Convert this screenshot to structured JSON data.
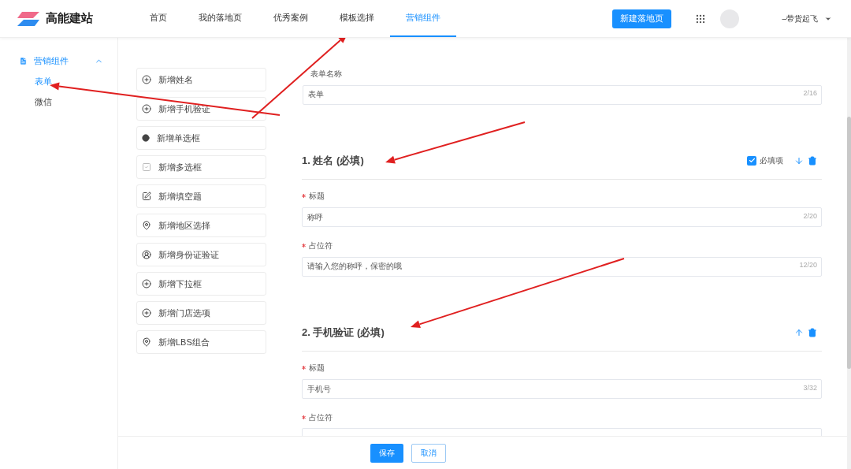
{
  "brand": {
    "name": "高能建站"
  },
  "nav": [
    {
      "label": "首页",
      "selected": false
    },
    {
      "label": "我的落地页",
      "selected": false
    },
    {
      "label": "优秀案例",
      "selected": false
    },
    {
      "label": "模板选择",
      "selected": false
    },
    {
      "label": "营销组件",
      "selected": true
    }
  ],
  "new_button": "新建落地页",
  "user": {
    "name": "–带货起飞"
  },
  "sidebar": {
    "group": {
      "label": "营销组件",
      "expanded": true,
      "children": [
        {
          "label": "表单",
          "selected": true
        },
        {
          "label": "微信",
          "selected": false
        }
      ]
    }
  },
  "components": [
    {
      "label": "新增姓名",
      "kind": "plus"
    },
    {
      "label": "新增手机验证",
      "kind": "plus"
    },
    {
      "label": "新增单选框",
      "kind": "radio"
    },
    {
      "label": "新增多选框",
      "kind": "checkbox"
    },
    {
      "label": "新增填空题",
      "kind": "edit"
    },
    {
      "label": "新增地区选择",
      "kind": "pin"
    },
    {
      "label": "新增身份证验证",
      "kind": "person"
    },
    {
      "label": "新增下拉框",
      "kind": "plus"
    },
    {
      "label": "新增门店选项",
      "kind": "plus"
    },
    {
      "label": "新增LBS组合",
      "kind": "pin"
    }
  ],
  "form_name": {
    "label": "表单名称",
    "value": "表单",
    "counter": "2/16"
  },
  "sections": [
    {
      "title": "1. 姓名 (必填)",
      "required_toggle": {
        "label": "必填项",
        "checked": true
      },
      "move_arrow": {
        "kind": "down"
      },
      "fields": [
        {
          "label": "标题",
          "required": true,
          "value": "称呼",
          "counter": "2/20"
        },
        {
          "label": "占位符",
          "required": true,
          "value": "请输入您的称呼，保密的哦",
          "counter": "12/20"
        }
      ]
    },
    {
      "title": "2. 手机验证 (必填)",
      "move_arrow": {
        "kind": "up"
      },
      "fields": [
        {
          "label": "标题",
          "required": true,
          "value": "手机号",
          "counter": "3/32"
        },
        {
          "label": "占位符",
          "required": true
        }
      ]
    }
  ],
  "footer": {
    "buttons": [
      {
        "label": "保存",
        "kind": "primary"
      },
      {
        "label": "取消",
        "kind": "secondary"
      }
    ]
  }
}
